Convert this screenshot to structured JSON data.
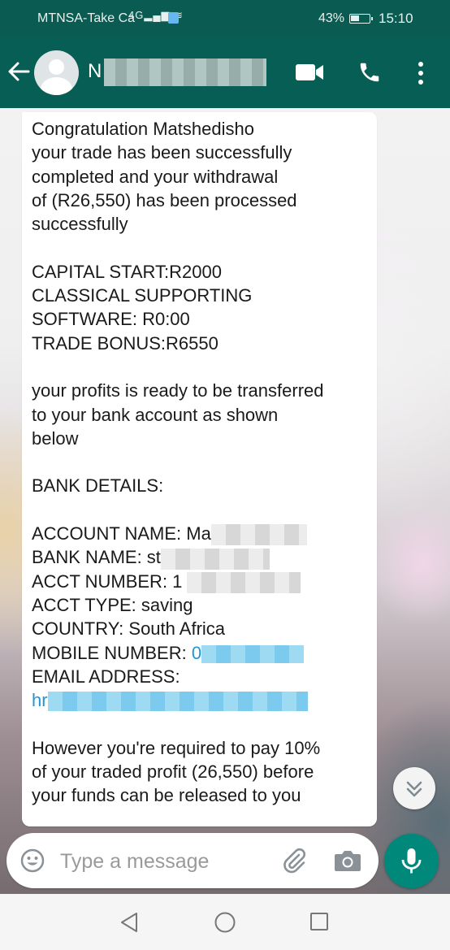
{
  "status_bar": {
    "carrier": "MTNSA-Take Ca",
    "network": "4G",
    "battery": "43%",
    "time": "15:10"
  },
  "header": {
    "contact_initial": "N",
    "icons": [
      "back-arrow-icon",
      "avatar",
      "video-call-icon",
      "voice-call-icon",
      "more-options-icon"
    ]
  },
  "message": {
    "lines": [
      "Congratulation Matshedisho",
      "your trade has been successfully",
      "completed and your withdrawal",
      "of (R26,550) has been processed",
      "successfully"
    ],
    "capital": "CAPITAL START:R2000",
    "software_1": "CLASSICAL SUPPORTING",
    "software_2": "SOFTWARE: R0:00",
    "bonus": "TRADE BONUS:R6550",
    "profits_1": "your profits is ready to be transferred",
    "profits_2": "to your bank account as shown",
    "profits_3": "below",
    "bank_heading": "BANK DETAILS:",
    "account_name": "ACCOUNT NAME: Ma",
    "bank_name": "BANK NAME: st",
    "acct_number": "ACCT NUMBER: 1",
    "acct_type": "ACCT TYPE: saving",
    "country": "COUNTRY: South Africa",
    "mobile_label": "MOBILE NUMBER: ",
    "mobile_value": "0",
    "email_label": "EMAIL ADDRESS:",
    "email_value": "hr",
    "however_1": "However you're required to pay 10%",
    "however_2": "of your traded profit (26,550) before",
    "however_3": "your funds can be released to you"
  },
  "composer": {
    "placeholder": "Type a message"
  },
  "colors": {
    "header": "#075e54",
    "status_bar": "#0a5c52",
    "mic_button": "#00897b",
    "link": "#2196d3"
  }
}
